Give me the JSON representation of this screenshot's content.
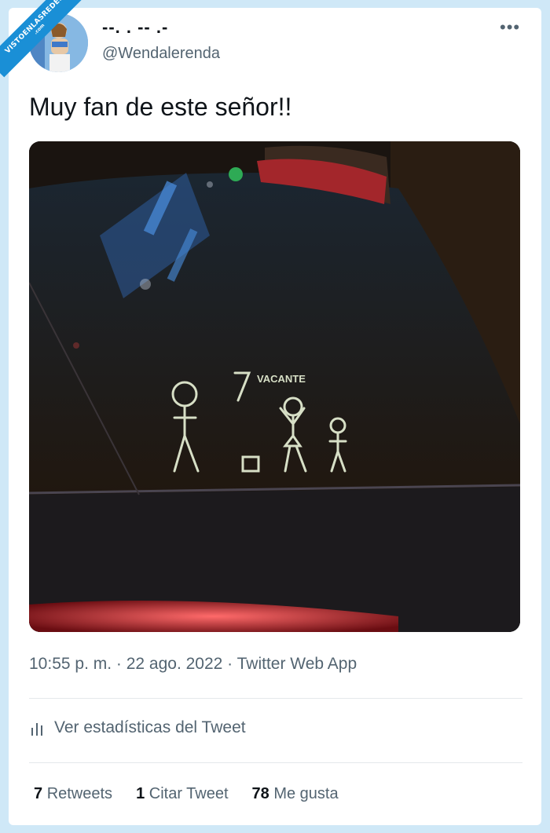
{
  "watermark": {
    "main": "VISTOENLASREDES",
    "sub": ".com"
  },
  "user": {
    "display_name": "--. . -- .-",
    "handle": "@Wendalerenda"
  },
  "tweet": {
    "text": "Muy fan de este señor!!"
  },
  "media": {
    "sticker_text": "VACANTE"
  },
  "meta": {
    "timestamp": "10:55 p. m. · 22 ago. 2022 · Twitter Web App"
  },
  "stats": {
    "label": "Ver estadísticas del Tweet"
  },
  "counts": [
    {
      "value": "7",
      "label": "Retweets"
    },
    {
      "value": "1",
      "label": "Citar Tweet"
    },
    {
      "value": "78",
      "label": "Me gusta"
    }
  ],
  "icons": {
    "more": "more-horizontal-icon",
    "stats": "bar-chart-icon"
  },
  "colors": {
    "background": "#cfe8f7",
    "text": "#0f1419",
    "secondary": "#536471",
    "watermark": "#1a8fd6"
  }
}
